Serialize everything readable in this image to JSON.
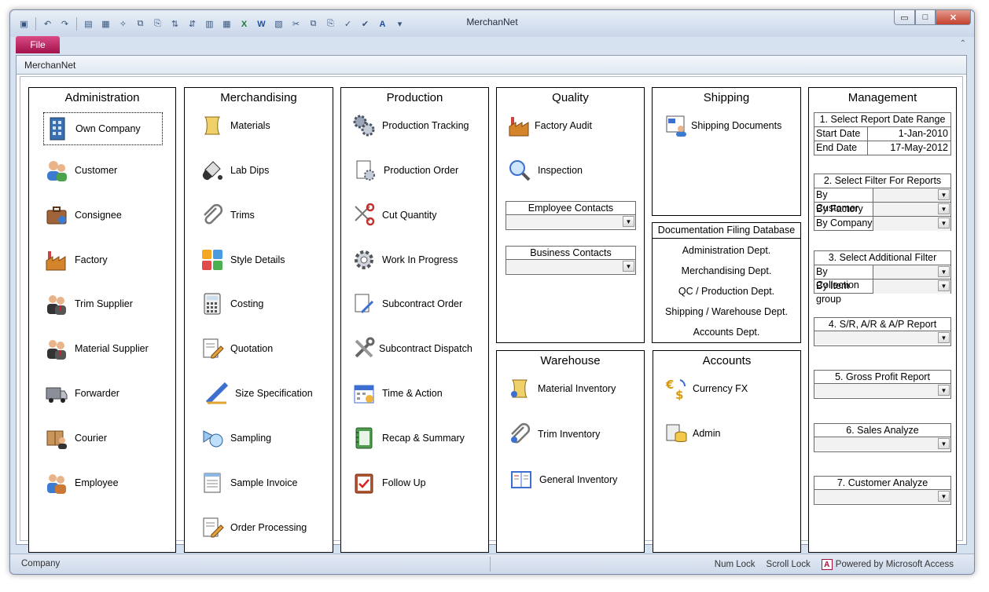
{
  "window": {
    "title": "MerchanNet",
    "file_tab": "File",
    "doc_tab": "MerchanNet",
    "min": "▭",
    "max": "□",
    "close": "✕",
    "collapse": "⌃"
  },
  "qat": [
    "access-icon",
    "undo-icon",
    "redo-icon",
    "new-icon",
    "folder-icon",
    "wand-icon",
    "copy-icon",
    "paste-icon",
    "sort-icon",
    "sort2-icon",
    "report-icon",
    "table-icon",
    "excel-icon",
    "word-icon",
    "pdf-icon",
    "cut-icon",
    "copy2-icon",
    "paste2-icon",
    "spell-icon",
    "check-icon",
    "font-color-icon",
    "dropdown-icon"
  ],
  "administration": {
    "title": "Administration",
    "items": [
      "Own Company",
      "Customer",
      "Consignee",
      "Factory",
      "Trim Supplier",
      "Material Supplier",
      "Forwarder",
      "Courier",
      "Employee"
    ]
  },
  "merchandising": {
    "title": "Merchandising",
    "items": [
      "Materials",
      "Lab Dips",
      "Trims",
      "Style Details",
      "Costing",
      "Quotation",
      "Size Specification",
      "Sampling",
      "Sample Invoice",
      "Order Processing"
    ]
  },
  "production": {
    "title": "Production",
    "items": [
      "Production Tracking",
      "Production Order",
      "Cut Quantity",
      "Work In Progress",
      "Subcontract Order",
      "Subcontract Dispatch",
      "Time & Action",
      "Recap & Summary",
      "Follow Up"
    ]
  },
  "quality": {
    "title": "Quality",
    "items": [
      "Factory Audit",
      "Inspection"
    ],
    "employee_contacts": "Employee Contacts",
    "business_contacts": "Business Contacts"
  },
  "shipping": {
    "title": "Shipping",
    "items": [
      "Shipping Documents"
    ]
  },
  "documentation": {
    "title": "Documentation Filing Database",
    "items": [
      "Administration Dept.",
      "Merchandising Dept.",
      "QC / Production Dept.",
      "Shipping / Warehouse Dept.",
      "Accounts Dept."
    ]
  },
  "warehouse": {
    "title": "Warehouse",
    "items": [
      "Material Inventory",
      "Trim Inventory",
      "General Inventory"
    ]
  },
  "accounts": {
    "title": "Accounts",
    "items": [
      "Currency FX",
      "Admin"
    ]
  },
  "management": {
    "title": "Management",
    "date_range": {
      "title": "1. Select Report Date Range",
      "start_label": "Start Date",
      "start": "1-Jan-2010",
      "end_label": "End Date",
      "end": "17-May-2012"
    },
    "filter": {
      "title": "2. Select Filter For Reports",
      "rows": [
        "By Customer",
        "By Factory",
        "By Company"
      ]
    },
    "additional": {
      "title": "3. Select Additional Filter",
      "rows": [
        "By Collection",
        "By Item group"
      ]
    },
    "reports": [
      "4. S/R, A/R & A/P Report",
      "5. Gross Profit Report",
      "6. Sales Analyze",
      "7. Customer Analyze"
    ]
  },
  "status": {
    "left": "Company",
    "num_lock": "Num Lock",
    "scroll_lock": "Scroll Lock",
    "powered": "Powered by Microsoft Access",
    "access_badge": "A"
  },
  "colors": {
    "file_tab": "#c2185b",
    "title_bar": "#d7e2f0"
  }
}
